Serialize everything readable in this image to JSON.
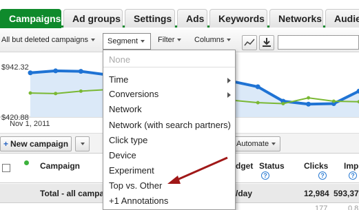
{
  "tabs": [
    {
      "label": "Campaigns",
      "active": true
    },
    {
      "label": "Ad groups"
    },
    {
      "label": "Settings"
    },
    {
      "label": "Ads"
    },
    {
      "label": "Keywords"
    },
    {
      "label": "Networks"
    },
    {
      "label": "Audien"
    }
  ],
  "toolbar": {
    "filter_view": "All but deleted campaigns",
    "segment": "Segment",
    "filter": "Filter",
    "columns": "Columns",
    "search_value": ""
  },
  "chart": {
    "y_top_label": "$942.32",
    "y_bottom_label": "$420.88",
    "x_start_label": "Nov 1, 2011"
  },
  "chart_data": {
    "type": "line",
    "x": [
      1,
      2,
      3,
      4,
      5,
      6,
      7,
      8,
      9,
      10,
      11,
      12,
      13,
      14
    ],
    "series": [
      {
        "values": [
          880,
          900,
          895,
          860,
          910,
          855,
          845,
          865,
          790,
          735,
          585,
          555,
          560,
          690
        ]
      },
      {
        "values": [
          670,
          665,
          690,
          705,
          580,
          560,
          575,
          590,
          595,
          570,
          560,
          620,
          585,
          580
        ]
      }
    ],
    "ylim": [
      420.88,
      942.32
    ],
    "colors": [
      "#1f73d4",
      "#7ab833"
    ],
    "grid": false
  },
  "actions": {
    "new_campaign": "New campaign",
    "automate": "Automate"
  },
  "table": {
    "headers": {
      "campaign": "Campaign",
      "budget": "dget",
      "status": "Status",
      "clicks": "Clicks",
      "impr": "Imp"
    },
    "total_row": {
      "label": "Total - all campa",
      "budget": "/day",
      "clicks": "12,984",
      "impr": "593,37"
    },
    "next_row": {
      "c1": "177",
      "c2": "0.8"
    }
  },
  "segment_menu": {
    "items": [
      {
        "label": "None",
        "disabled": true
      },
      {
        "label": "Time",
        "submenu": true
      },
      {
        "label": "Conversions",
        "submenu": true
      },
      {
        "label": "Network"
      },
      {
        "label": "Network (with search partners)"
      },
      {
        "label": "Click type"
      },
      {
        "label": "Device"
      },
      {
        "label": "Experiment"
      },
      {
        "label": "Top vs. Other"
      },
      {
        "label": "+1 Annotations"
      }
    ]
  }
}
